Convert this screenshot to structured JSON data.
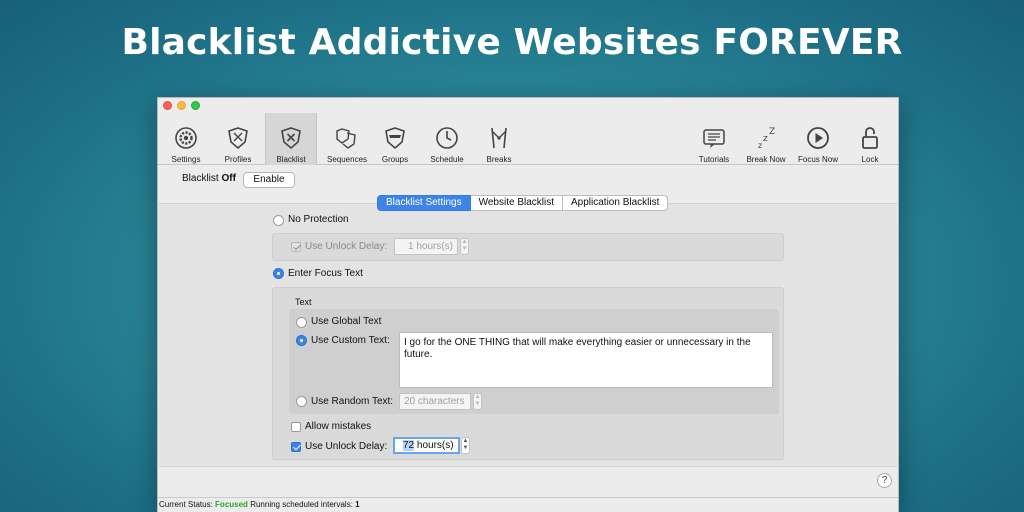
{
  "headline": "Blacklist Addictive Websites FOREVER",
  "toolbar": {
    "left": [
      {
        "label": "Settings",
        "icon": "gear-icon"
      },
      {
        "label": "Profiles",
        "icon": "shield-icon"
      },
      {
        "label": "Blacklist",
        "icon": "blacklist-shield-icon"
      },
      {
        "label": "Sequences",
        "icon": "sequences-icon"
      },
      {
        "label": "Groups",
        "icon": "groups-icon"
      },
      {
        "label": "Schedule",
        "icon": "clock-icon"
      },
      {
        "label": "Breaks",
        "icon": "breaks-icon"
      }
    ],
    "right": [
      {
        "label": "Tutorials",
        "icon": "tutorials-icon"
      },
      {
        "label": "Break Now",
        "icon": "sleep-icon"
      },
      {
        "label": "Focus Now",
        "icon": "play-icon"
      },
      {
        "label": "Lock",
        "icon": "lock-icon"
      }
    ],
    "active": "Blacklist"
  },
  "blacklist_status": {
    "label": "Blacklist",
    "state": "Off",
    "button": "Enable"
  },
  "tabs": [
    {
      "label": "Blacklist Settings",
      "active": true
    },
    {
      "label": "Website Blacklist",
      "active": false
    },
    {
      "label": "Application Blacklist",
      "active": false
    }
  ],
  "no_protection": {
    "label": "No Protection",
    "unlock_delay_label": "Use Unlock Delay:",
    "unlock_delay_value": "1 hours(s)"
  },
  "focus_text": {
    "label": "Enter Focus Text",
    "section_title": "Text",
    "global_label": "Use Global Text",
    "custom_label": "Use Custom Text:",
    "custom_text": "I go for the ONE THING that will make everything easier or unnecessary in the future.",
    "random_label": "Use Random Text:",
    "random_value": "20 characters",
    "allow_mistakes": "Allow mistakes",
    "unlock_delay_label": "Use Unlock Delay:",
    "unlock_delay_number": "72",
    "unlock_delay_unit": " hours(s)"
  },
  "help_label": "?",
  "status_bar": {
    "current_label": "Current Status:",
    "current_value": "Focused",
    "intervals_label": "Running scheduled intervals:",
    "intervals_value": "1"
  },
  "colors": {
    "accent": "#3d84e6",
    "focused": "#2aa52a"
  }
}
